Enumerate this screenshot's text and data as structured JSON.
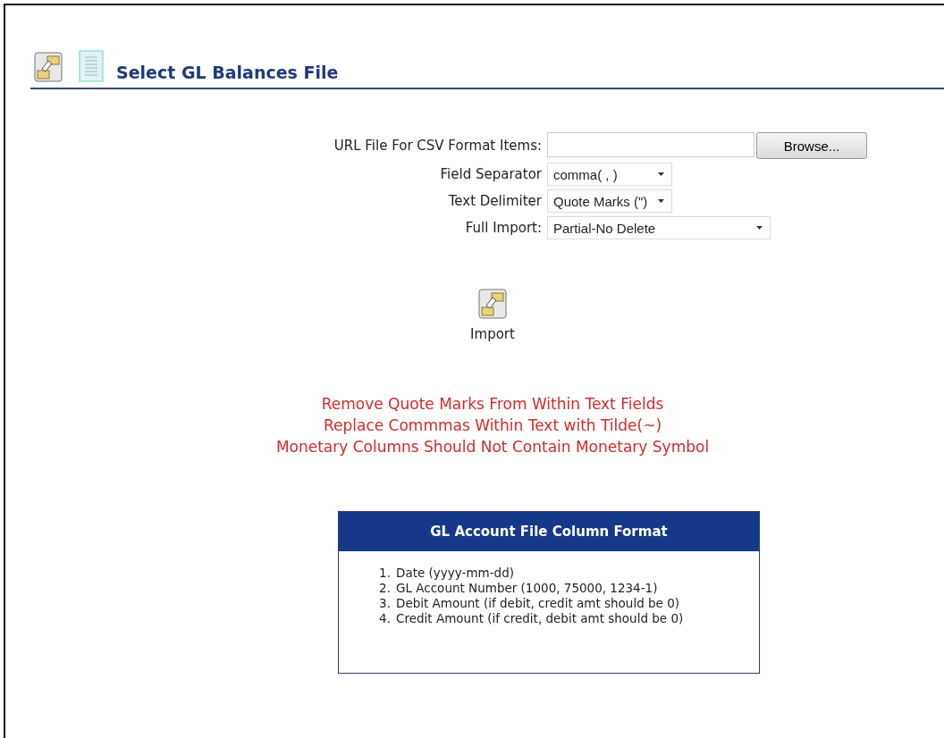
{
  "header": {
    "title": "Select GL Balances File"
  },
  "form": {
    "file_label": "URL File For CSV Format Items:",
    "browse_button": "Browse...",
    "selects": [
      {
        "label": "Field Separator",
        "value": "comma( , )"
      },
      {
        "label": "Text Delimiter",
        "value": "Quote Marks (\")"
      },
      {
        "label": "Full Import:",
        "value": "Partial-No Delete"
      }
    ]
  },
  "import_button": {
    "label": "Import"
  },
  "notes": [
    "Remove Quote Marks From Within Text Fields",
    "Replace Commmas Within Text with Tilde(~)",
    "Monetary Columns Should Not Contain Monetary Symbol"
  ],
  "format_box": {
    "title": "GL Account File Column Format",
    "items": [
      {
        "number": "1.",
        "text": "Date (yyyy-mm-dd)"
      },
      {
        "number": "2.",
        "text": "GL Account Number (1000, 75000, 1234-1)"
      },
      {
        "number": "3.",
        "text": "Debit Amount (if debit, credit amt should be 0)"
      },
      {
        "number": "4.",
        "text": "Credit Amount (if credit, debit amt should be 0)"
      }
    ]
  }
}
